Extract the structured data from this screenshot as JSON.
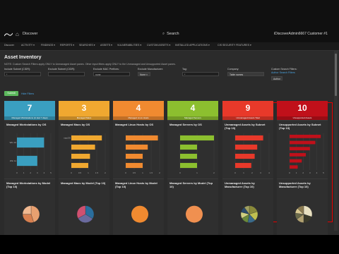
{
  "topbar": {
    "app_name": "Discover",
    "search_label": "Search",
    "user_text": "iDiscoverAdmin6667   Customer #1"
  },
  "nav": {
    "items": [
      "Discover",
      "ACTIVITY ▾",
      "FINDINGS ▾",
      "REPORTS ▾",
      "SEARCHES ▾",
      "ASSETS ▾",
      "VULNERABILITIES ▾",
      "CUSTOM ASSETS ▾",
      "INSTALLED APPLICATIONS ▾",
      "CIS SECURITY FEATURES ▾"
    ]
  },
  "page": {
    "title": "Asset Inventory",
    "note": "NOTE: Custom Search Filters apply ONLY to Unmanaged Asset panes. Other input filters apply ONLY to the Unmanaged and Unsupported Asset panes.",
    "filters": [
      {
        "label": "Include Subnet (CIDR):",
        "value": "*"
      },
      {
        "label": "Exclude Subnet (CIDR):",
        "value": ""
      },
      {
        "label": "Exclude MAC Prefixes:",
        "value": "none"
      },
      {
        "label": "Exclude Manufacturer:",
        "value": "None ×"
      },
      {
        "label": "Tag:",
        "value": "*"
      },
      {
        "label": "Company:",
        "value": "Table names"
      },
      {
        "label": "Custom Search Filters:",
        "value": "Author"
      }
    ],
    "custom_filter_link": "Author Search Filters",
    "submit_label": "Submit",
    "reset_label": "Hide Filters"
  },
  "kpis": [
    {
      "value": "7",
      "label": "Managed Workstations (in last 7 days)",
      "color": "#3a9fc0"
    },
    {
      "value": "3",
      "label": "Managed Macs",
      "color": "#f0a830"
    },
    {
      "value": "4",
      "label": "Managed Linux Hosts",
      "color": "#f08a30"
    },
    {
      "value": "4",
      "label": "Managed Servers",
      "color": "#8cbf2f"
    },
    {
      "value": "9",
      "label": "Unmanaged Assets Total",
      "color": "#e8392a"
    },
    {
      "value": "10",
      "label": "Unsupported Assets",
      "color": "#c0101a"
    }
  ],
  "bar_panels": [
    {
      "title": "Managed Workstations by OS",
      "color": "#3a9fc0",
      "categories": [
        "Win 10",
        "Win 11"
      ],
      "values": [
        4,
        3
      ],
      "xlim": [
        0,
        5
      ],
      "ticks": [
        "0",
        "1",
        "2",
        "3",
        "4",
        "5"
      ]
    },
    {
      "title": "Managed Macs by OS",
      "color": "#f0a830",
      "categories": [
        "macOS",
        "",
        "",
        ""
      ],
      "values": [
        1.8,
        1.4,
        1.1,
        1.0
      ],
      "xlim": [
        0,
        2
      ],
      "ticks": [
        "0",
        "0.5",
        "1",
        "1.5",
        "2"
      ]
    },
    {
      "title": "Managed Linux Hosts by OS",
      "color": "#f08a30",
      "categories": [
        "",
        "",
        "",
        ""
      ],
      "values": [
        1.9,
        1.3,
        1.0,
        1.0
      ],
      "xlim": [
        0,
        2
      ],
      "ticks": [
        "0",
        "0.5",
        "1",
        "1.5",
        "2"
      ]
    },
    {
      "title": "Managed Servers by OS",
      "color": "#8cbf2f",
      "categories": [
        "",
        "",
        "",
        ""
      ],
      "values": [
        2.0,
        1.0,
        1.0,
        1.0
      ],
      "xlim": [
        0,
        2
      ],
      "ticks": [
        "0",
        "1",
        "2"
      ]
    },
    {
      "title": "Unmanaged Assets by Subnet (Top 10)",
      "color": "#e8392a",
      "categories": [
        "",
        "",
        "",
        ""
      ],
      "values": [
        3.3,
        2.6,
        2.3,
        1.9
      ],
      "xlim": [
        0,
        4
      ],
      "ticks": [
        "0",
        "1",
        "2",
        "3",
        "4"
      ]
    },
    {
      "title": "Unsupported Assets by Subnet (Top 10)",
      "color": "#c0101a",
      "categories": [
        "",
        "",
        "",
        "",
        "",
        ""
      ],
      "values": [
        4.6,
        3.8,
        3.0,
        2.4,
        1.8,
        1.2
      ],
      "xlim": [
        0,
        5
      ],
      "ticks": [
        "0",
        "1",
        "2",
        "3",
        "4",
        "5"
      ]
    }
  ],
  "pie_panels": [
    {
      "title": "Managed Workstations by Model (Top 10)",
      "slices": [
        0.45,
        0.3,
        0.25
      ],
      "colors": [
        "#e8a070",
        "#d88050",
        "#f0b890"
      ]
    },
    {
      "title": "Managed Macs by Model (Top 10)",
      "slices": [
        0.34,
        0.33,
        0.33
      ],
      "colors": [
        "#2a6e9e",
        "#6a6a9e",
        "#d05070"
      ]
    },
    {
      "title": "Managed Linux Hosts by Model (Top 10)",
      "slices": [
        1.0
      ],
      "colors": [
        "#f08a30"
      ]
    },
    {
      "title": "Managed Servers by Model (Top 10)",
      "slices": [
        1.0
      ],
      "colors": [
        "#f09050"
      ]
    },
    {
      "title": "Unmanaged Assets by Manufacturer (Top 10)",
      "slices": [
        0.2,
        0.18,
        0.15,
        0.14,
        0.12,
        0.11,
        0.1
      ],
      "colors": [
        "#8a8a3a",
        "#c0c050",
        "#3a6a8a",
        "#6a8a3a",
        "#d0d080",
        "#2a4a6a",
        "#a0a060"
      ]
    },
    {
      "title": "Unsupported Assets by Manufacturer (Top 10)",
      "slices": [
        0.3,
        0.2,
        0.15,
        0.12,
        0.1,
        0.13
      ],
      "colors": [
        "#e8e0c0",
        "#3a3a2a",
        "#b0a070",
        "#6a6a4a",
        "#d8c890",
        "#8a7a50"
      ]
    }
  ]
}
